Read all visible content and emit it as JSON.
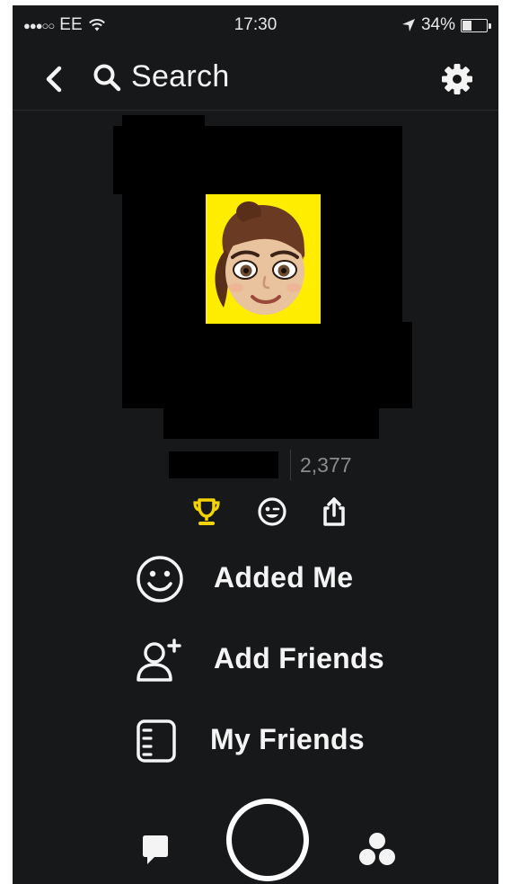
{
  "status_bar": {
    "signal": "●●●○○",
    "carrier": "EE",
    "time": "17:30",
    "battery_percent": "34%"
  },
  "nav": {
    "search_label": "Search"
  },
  "profile": {
    "score": "2,377"
  },
  "menu": [
    {
      "label": "Added Me",
      "icon": "smiley-icon"
    },
    {
      "label": "Add Friends",
      "icon": "add-person-icon"
    },
    {
      "label": "My Friends",
      "icon": "notebook-icon"
    }
  ],
  "colors": {
    "background": "#17181a",
    "accent_yellow": "#ffed00",
    "trophy_yellow": "#f5d300",
    "score_gray": "#8a8b8d"
  }
}
